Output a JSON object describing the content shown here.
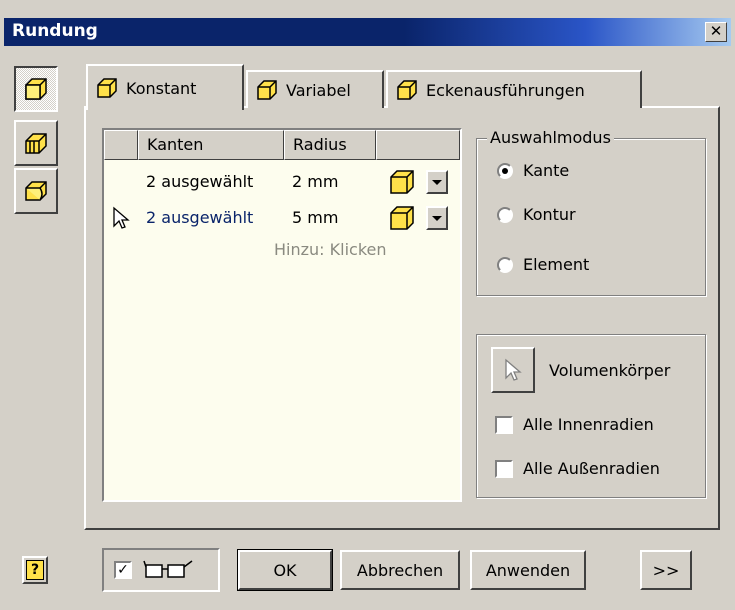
{
  "window": {
    "title": "Rundung",
    "close_glyph": "✕"
  },
  "side_buttons": [
    {
      "icon": "fillet-constant-icon"
    },
    {
      "icon": "face-fillet-icon"
    },
    {
      "icon": "full-round-fillet-icon"
    }
  ],
  "tabs": [
    {
      "label": "Konstant",
      "icon": "cube-icon",
      "active": true
    },
    {
      "label": "Variabel",
      "icon": "cube-icon",
      "active": false
    },
    {
      "label": "Eckenausführungen",
      "icon": "cube-icon",
      "active": false
    }
  ],
  "table": {
    "headers": [
      "Kanten",
      "Radius"
    ],
    "rows": [
      {
        "edges": "2 ausgewählt",
        "radius": "2 mm",
        "selected": false
      },
      {
        "edges": "2 ausgewählt",
        "radius": "5 mm",
        "selected": true
      }
    ],
    "add_hint": "Hinzu: Klicken"
  },
  "selection_mode": {
    "legend": "Auswahlmodus",
    "options": [
      {
        "label": "Kante",
        "checked": true
      },
      {
        "label": "Kontur",
        "checked": false
      },
      {
        "label": "Element",
        "checked": false
      }
    ]
  },
  "body_panel": {
    "solid_label": "Volumenkörper",
    "checkboxes": [
      {
        "label": "Alle Innenradien",
        "checked": false
      },
      {
        "label": "Alle Außenradien",
        "checked": false
      }
    ]
  },
  "footer": {
    "help_glyph": "?",
    "preview_checked": true,
    "ok_label": "OK",
    "cancel_label": "Abbrechen",
    "apply_label": "Anwenden",
    "more_label": ">>"
  },
  "colors": {
    "title_bar": "#0a246a",
    "face": "#d4d0c8",
    "list_bg": "#fdfdee",
    "cube_yellow": "#ffe14a",
    "selected_text": "#0a246a"
  }
}
